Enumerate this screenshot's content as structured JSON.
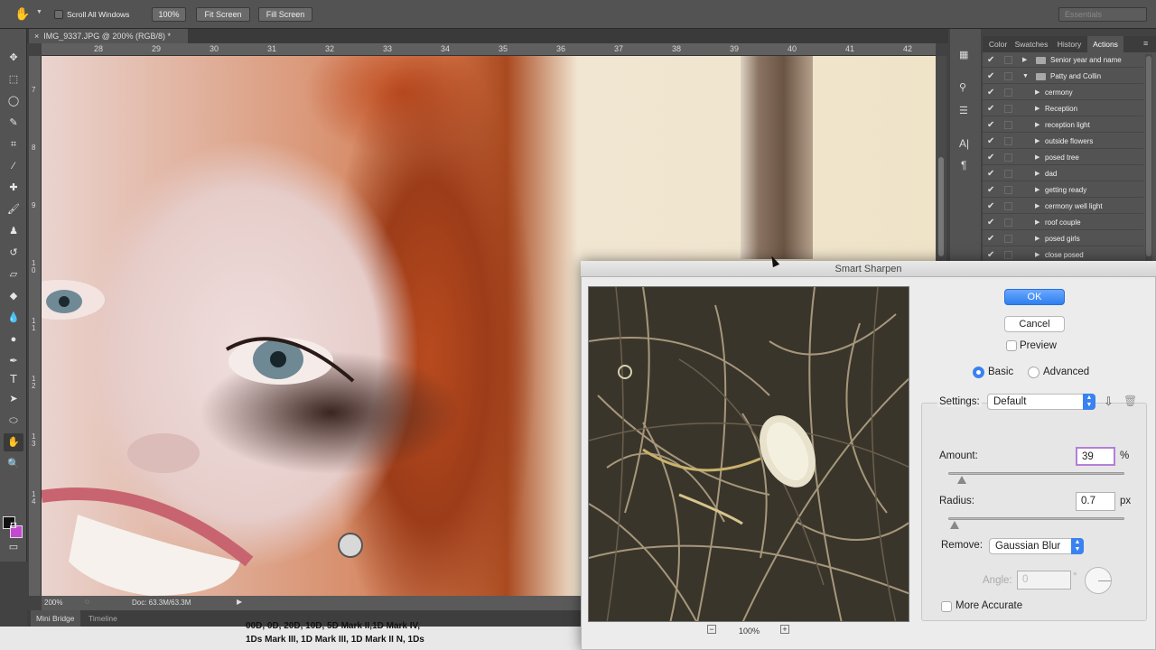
{
  "options_bar": {
    "scroll_all_windows": "Scroll All Windows",
    "zoom_100": "100%",
    "fit_screen": "Fit Screen",
    "fill_screen": "Fill Screen",
    "workspace": "Essentials"
  },
  "document": {
    "tab_title": "IMG_9337.JPG @ 200% (RGB/8) *",
    "close_glyph": "×",
    "ruler_h": [
      "28",
      "29",
      "30",
      "31",
      "32",
      "33",
      "34",
      "35",
      "36",
      "37",
      "38",
      "39",
      "40",
      "41",
      "42"
    ],
    "ruler_v": [
      "7",
      "8",
      "9",
      "1\n0",
      "1\n1",
      "1\n2",
      "1\n3",
      "1\n4"
    ],
    "zoom": "200%",
    "doc_size": "Doc: 63.3M/63.3M"
  },
  "bottom_tabs": {
    "mini_bridge": "Mini Bridge",
    "timeline": "Timeline"
  },
  "desktop_text": {
    "line1": "00D, 0D, 20D, 10D, 5D Mark II,1D Mark IV,",
    "line2": "1Ds Mark III, 1D Mark III, 1D Mark II N, 1Ds"
  },
  "panel": {
    "tabs": [
      "Color",
      "Swatches",
      "History",
      "Actions"
    ],
    "active_tab": "Actions",
    "actions": [
      {
        "label": "Senior year and name",
        "type": "set",
        "expanded": false
      },
      {
        "label": "Patty and Collin",
        "type": "set",
        "expanded": true
      },
      {
        "label": "cermony",
        "type": "action"
      },
      {
        "label": "Reception",
        "type": "action"
      },
      {
        "label": "reception light",
        "type": "action"
      },
      {
        "label": "outside flowers",
        "type": "action"
      },
      {
        "label": "posed tree",
        "type": "action"
      },
      {
        "label": "dad",
        "type": "action"
      },
      {
        "label": "getting ready",
        "type": "action"
      },
      {
        "label": "cermony well light",
        "type": "action"
      },
      {
        "label": "roof couple",
        "type": "action"
      },
      {
        "label": "posed girls",
        "type": "action"
      },
      {
        "label": "close posed",
        "type": "action"
      }
    ]
  },
  "dialog": {
    "title": "Smart Sharpen",
    "ok": "OK",
    "cancel": "Cancel",
    "preview": "Preview",
    "basic": "Basic",
    "advanced": "Advanced",
    "settings_label": "Settings:",
    "settings_value": "Default",
    "amount_label": "Amount:",
    "amount_value": "39",
    "amount_unit": "%",
    "amount_fraction": 0.078,
    "radius_label": "Radius:",
    "radius_value": "0.7",
    "radius_unit": "px",
    "radius_fraction": 0.035,
    "remove_label": "Remove:",
    "remove_value": "Gaussian Blur",
    "angle_label": "Angle:",
    "angle_value": "0",
    "angle_unit": "°",
    "more_accurate": "More Accurate",
    "preview_zoom": "100%",
    "zoom_out": "−",
    "zoom_in": "+"
  },
  "colors": {
    "accent": "#3a82f0",
    "panel_bg": "#535353",
    "dialog_bg": "#ececec"
  }
}
